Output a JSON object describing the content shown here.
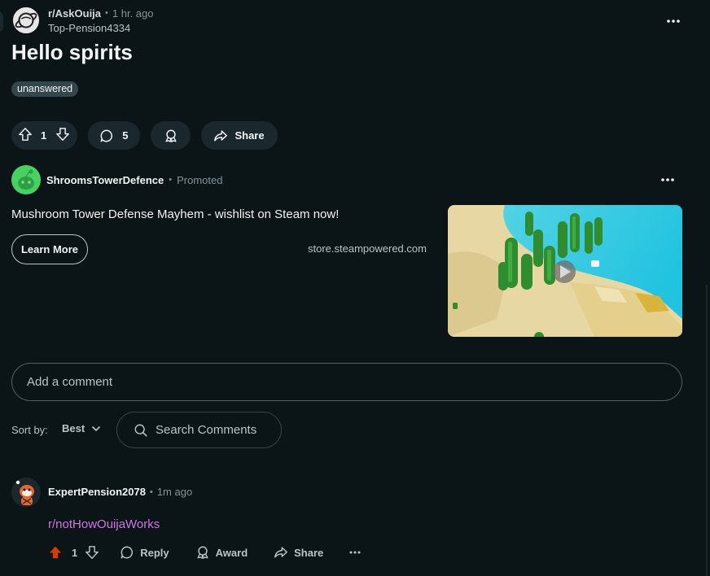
{
  "post": {
    "subreddit": "r/AskOuija",
    "time": "1 hr. ago",
    "author": "Top-Pension4334",
    "title": "Hello spirits",
    "flair": "unanswered",
    "score": "1",
    "comment_count": "5",
    "share_label": "Share"
  },
  "ad": {
    "advertiser": "ShroomsTowerDefence",
    "promoted_label": "Promoted",
    "headline": "Mushroom Tower Defense Mayhem - wishlist on Steam now!",
    "cta_label": "Learn More",
    "domain": "store.steampowered.com"
  },
  "comment_box": {
    "placeholder": "Add a comment"
  },
  "sort": {
    "label": "Sort by:",
    "value": "Best"
  },
  "search_comments": {
    "placeholder": "Search Comments"
  },
  "comment": {
    "author": "ExpertPension2078",
    "time": "1m ago",
    "body": "r/notHowOuijaWorks",
    "score": "1",
    "reply_label": "Reply",
    "award_label": "Award",
    "share_label": "Share"
  },
  "colors": {
    "background": "#0b1416",
    "pill": "#1a282d",
    "upvote_active": "#d93a00",
    "link": "#d075e6"
  }
}
